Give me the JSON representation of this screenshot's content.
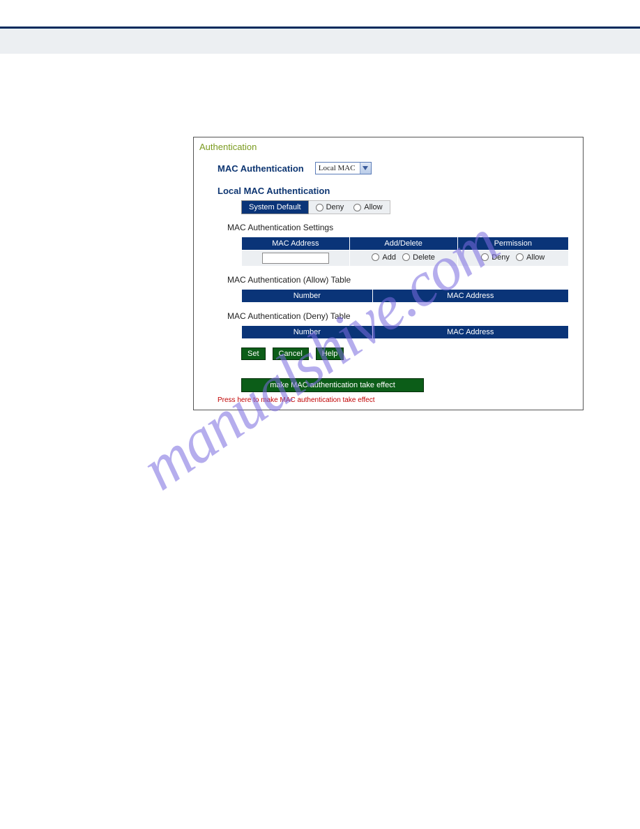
{
  "watermark": "manualshive.com",
  "panel": {
    "title": "Authentication",
    "macAuth": {
      "label": "MAC Authentication",
      "selected": "Local MAC"
    },
    "localMacTitle": "Local MAC Authentication",
    "systemDefault": {
      "label": "System Default",
      "denyLabel": "Deny",
      "allowLabel": "Allow"
    },
    "settingsHeading": "MAC Authentication Settings",
    "settingsTable": {
      "headers": {
        "mac": "MAC Address",
        "addDelete": "Add/Delete",
        "permission": "Permission"
      },
      "row": {
        "addLabel": "Add",
        "deleteLabel": "Delete",
        "denyLabel": "Deny",
        "allowLabel": "Allow"
      }
    },
    "allowTableHeading": "MAC Authentication (Allow) Table",
    "allowTable": {
      "headers": {
        "number": "Number",
        "mac": "MAC Address"
      }
    },
    "denyTableHeading": "MAC Authentication (Deny) Table",
    "denyTable": {
      "headers": {
        "number": "Number",
        "mac": "MAC Address"
      }
    },
    "buttons": {
      "set": "Set",
      "cancel": "Cancel",
      "help": "Help",
      "effect": "make MAC authentication take effect"
    },
    "note": "Press here to make MAC authentication take effect"
  }
}
